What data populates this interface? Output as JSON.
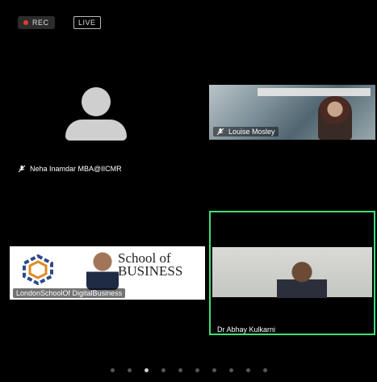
{
  "status": {
    "rec_label": "REC",
    "live_label": "LIVE"
  },
  "participants": [
    {
      "name": "Neha Inamdar MBA@IICMR",
      "muted": true,
      "video": false
    },
    {
      "name": "Louise Mosley",
      "muted": true,
      "video": true
    },
    {
      "name": "LondonSchoolOf DigitalBusiness",
      "muted": false,
      "video": true,
      "slide_text": "School of BUSINESS"
    },
    {
      "name": "Dr Abhay Kulkarni",
      "muted": false,
      "video": true,
      "active_speaker": true
    }
  ],
  "pagination": {
    "total": 10,
    "active_index": 2
  },
  "colors": {
    "active_speaker_border": "#3ee07a",
    "rec_dot": "#e53935"
  },
  "icons": {
    "muted": "mic-muted-icon",
    "avatar": "person-avatar-icon"
  }
}
